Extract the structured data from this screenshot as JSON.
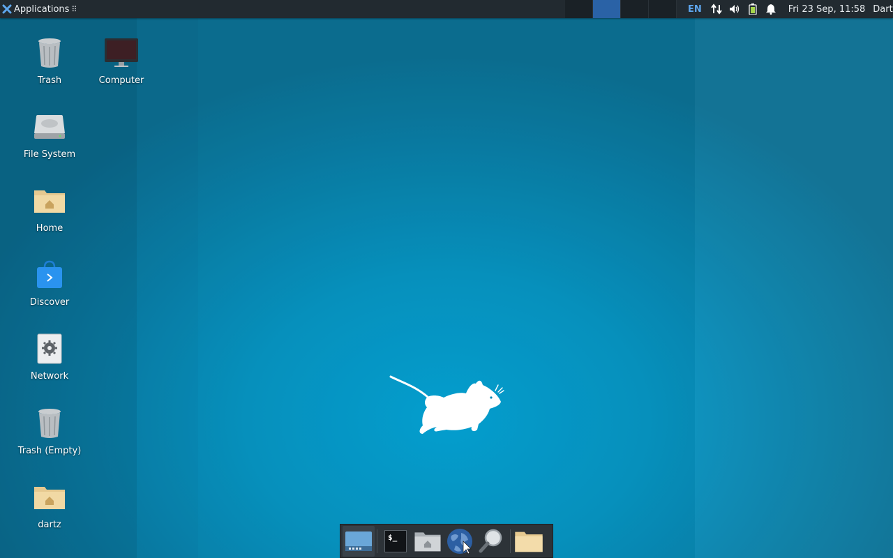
{
  "panel": {
    "apps_label": "Applications",
    "apps_dots": "⠿",
    "lang": "EN",
    "clock": "Fri 23 Sep, 11:58",
    "user": "Dartz",
    "active_workspace_index": 1
  },
  "desktop": {
    "icons": [
      {
        "label": "Trash",
        "icon": "trash-icon"
      },
      {
        "label": "Computer",
        "icon": "computer-icon"
      },
      {
        "label": "File System",
        "icon": "drive-icon"
      },
      {
        "label": "Home",
        "icon": "home-folder-icon"
      },
      {
        "label": "Discover",
        "icon": "discover-icon"
      },
      {
        "label": "Network",
        "icon": "gear-icon"
      },
      {
        "label": "Trash (Empty)",
        "icon": "trash-icon"
      },
      {
        "label": "dartz",
        "icon": "home-folder-icon"
      }
    ]
  },
  "dock": {
    "items": [
      {
        "name": "show-desktop",
        "icon": "show-desktop-icon"
      },
      {
        "name": "terminal",
        "icon": "terminal-icon"
      },
      {
        "name": "file-manager",
        "icon": "home-folder-icon"
      },
      {
        "name": "web-browser",
        "icon": "globe-icon"
      },
      {
        "name": "app-finder",
        "icon": "magnifier-icon"
      },
      {
        "name": "folder",
        "icon": "folder-icon"
      }
    ],
    "terminal_glyph": "$_"
  },
  "colors": {
    "panel_bg": "#222a30",
    "workspace_active": "#2a62a6",
    "lang_accent": "#5ea7ef",
    "desktop_bg": "#0795c3"
  }
}
